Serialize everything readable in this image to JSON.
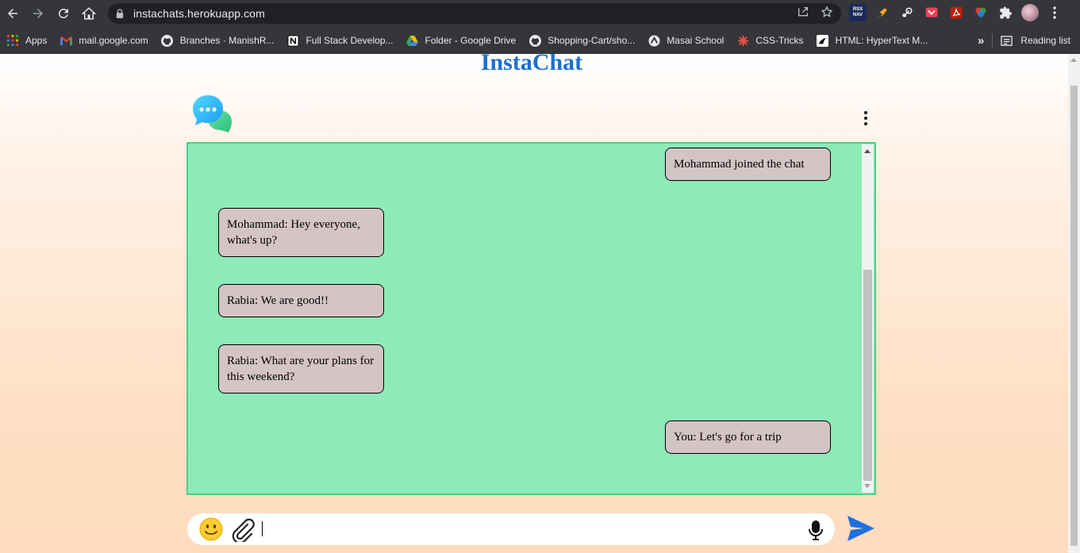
{
  "browser": {
    "url": "instachats.herokuapp.com",
    "bookmarks": [
      {
        "label": "Apps",
        "icon": "apps-grid-icon"
      },
      {
        "label": "mail.google.com",
        "icon": "gmail-icon"
      },
      {
        "label": "Branches · ManishR...",
        "icon": "github-icon"
      },
      {
        "label": "Full Stack Develop...",
        "icon": "notion-icon"
      },
      {
        "label": "Folder - Google Drive",
        "icon": "google-drive-icon"
      },
      {
        "label": "Shopping-Cart/sho...",
        "icon": "github-icon"
      },
      {
        "label": "Masai School",
        "icon": "masai-icon"
      },
      {
        "label": "CSS-Tricks",
        "icon": "css-tricks-icon"
      },
      {
        "label": "HTML: HyperText M...",
        "icon": "mdn-icon"
      }
    ],
    "more_bookmarks": "»",
    "reading_list": "Reading list",
    "extensions": [
      {
        "name": "rss-nav-extension-icon",
        "text": "RSS NAV",
        "color": "#1a2a5a"
      },
      {
        "name": "pencil-extension-icon",
        "text": "",
        "color": "#35363a"
      },
      {
        "name": "steam-extension-icon",
        "text": "",
        "color": "#35363a"
      },
      {
        "name": "pocket-extension-icon",
        "text": "",
        "color": "#ef3f56"
      },
      {
        "name": "pdf-extension-icon",
        "text": "",
        "color": "#c11e07"
      },
      {
        "name": "color-picker-extension-icon",
        "text": "",
        "color": "#35363a"
      }
    ]
  },
  "app": {
    "title": "InstaChat",
    "brand_color": "#1e6fd0",
    "chat_bg": "#8eeab7"
  },
  "messages": [
    {
      "side": "right",
      "text": "Mohammad joined the chat"
    },
    {
      "side": "left",
      "text": "Mohammad: Hey everyone, what's up?"
    },
    {
      "side": "left",
      "text": "Rabia: We are good!!"
    },
    {
      "side": "left",
      "text": "Rabia: What are your plans for this weekend?"
    },
    {
      "side": "right",
      "text": "You: Let's go for a trip"
    }
  ],
  "composer": {
    "value": "",
    "placeholder": ""
  }
}
